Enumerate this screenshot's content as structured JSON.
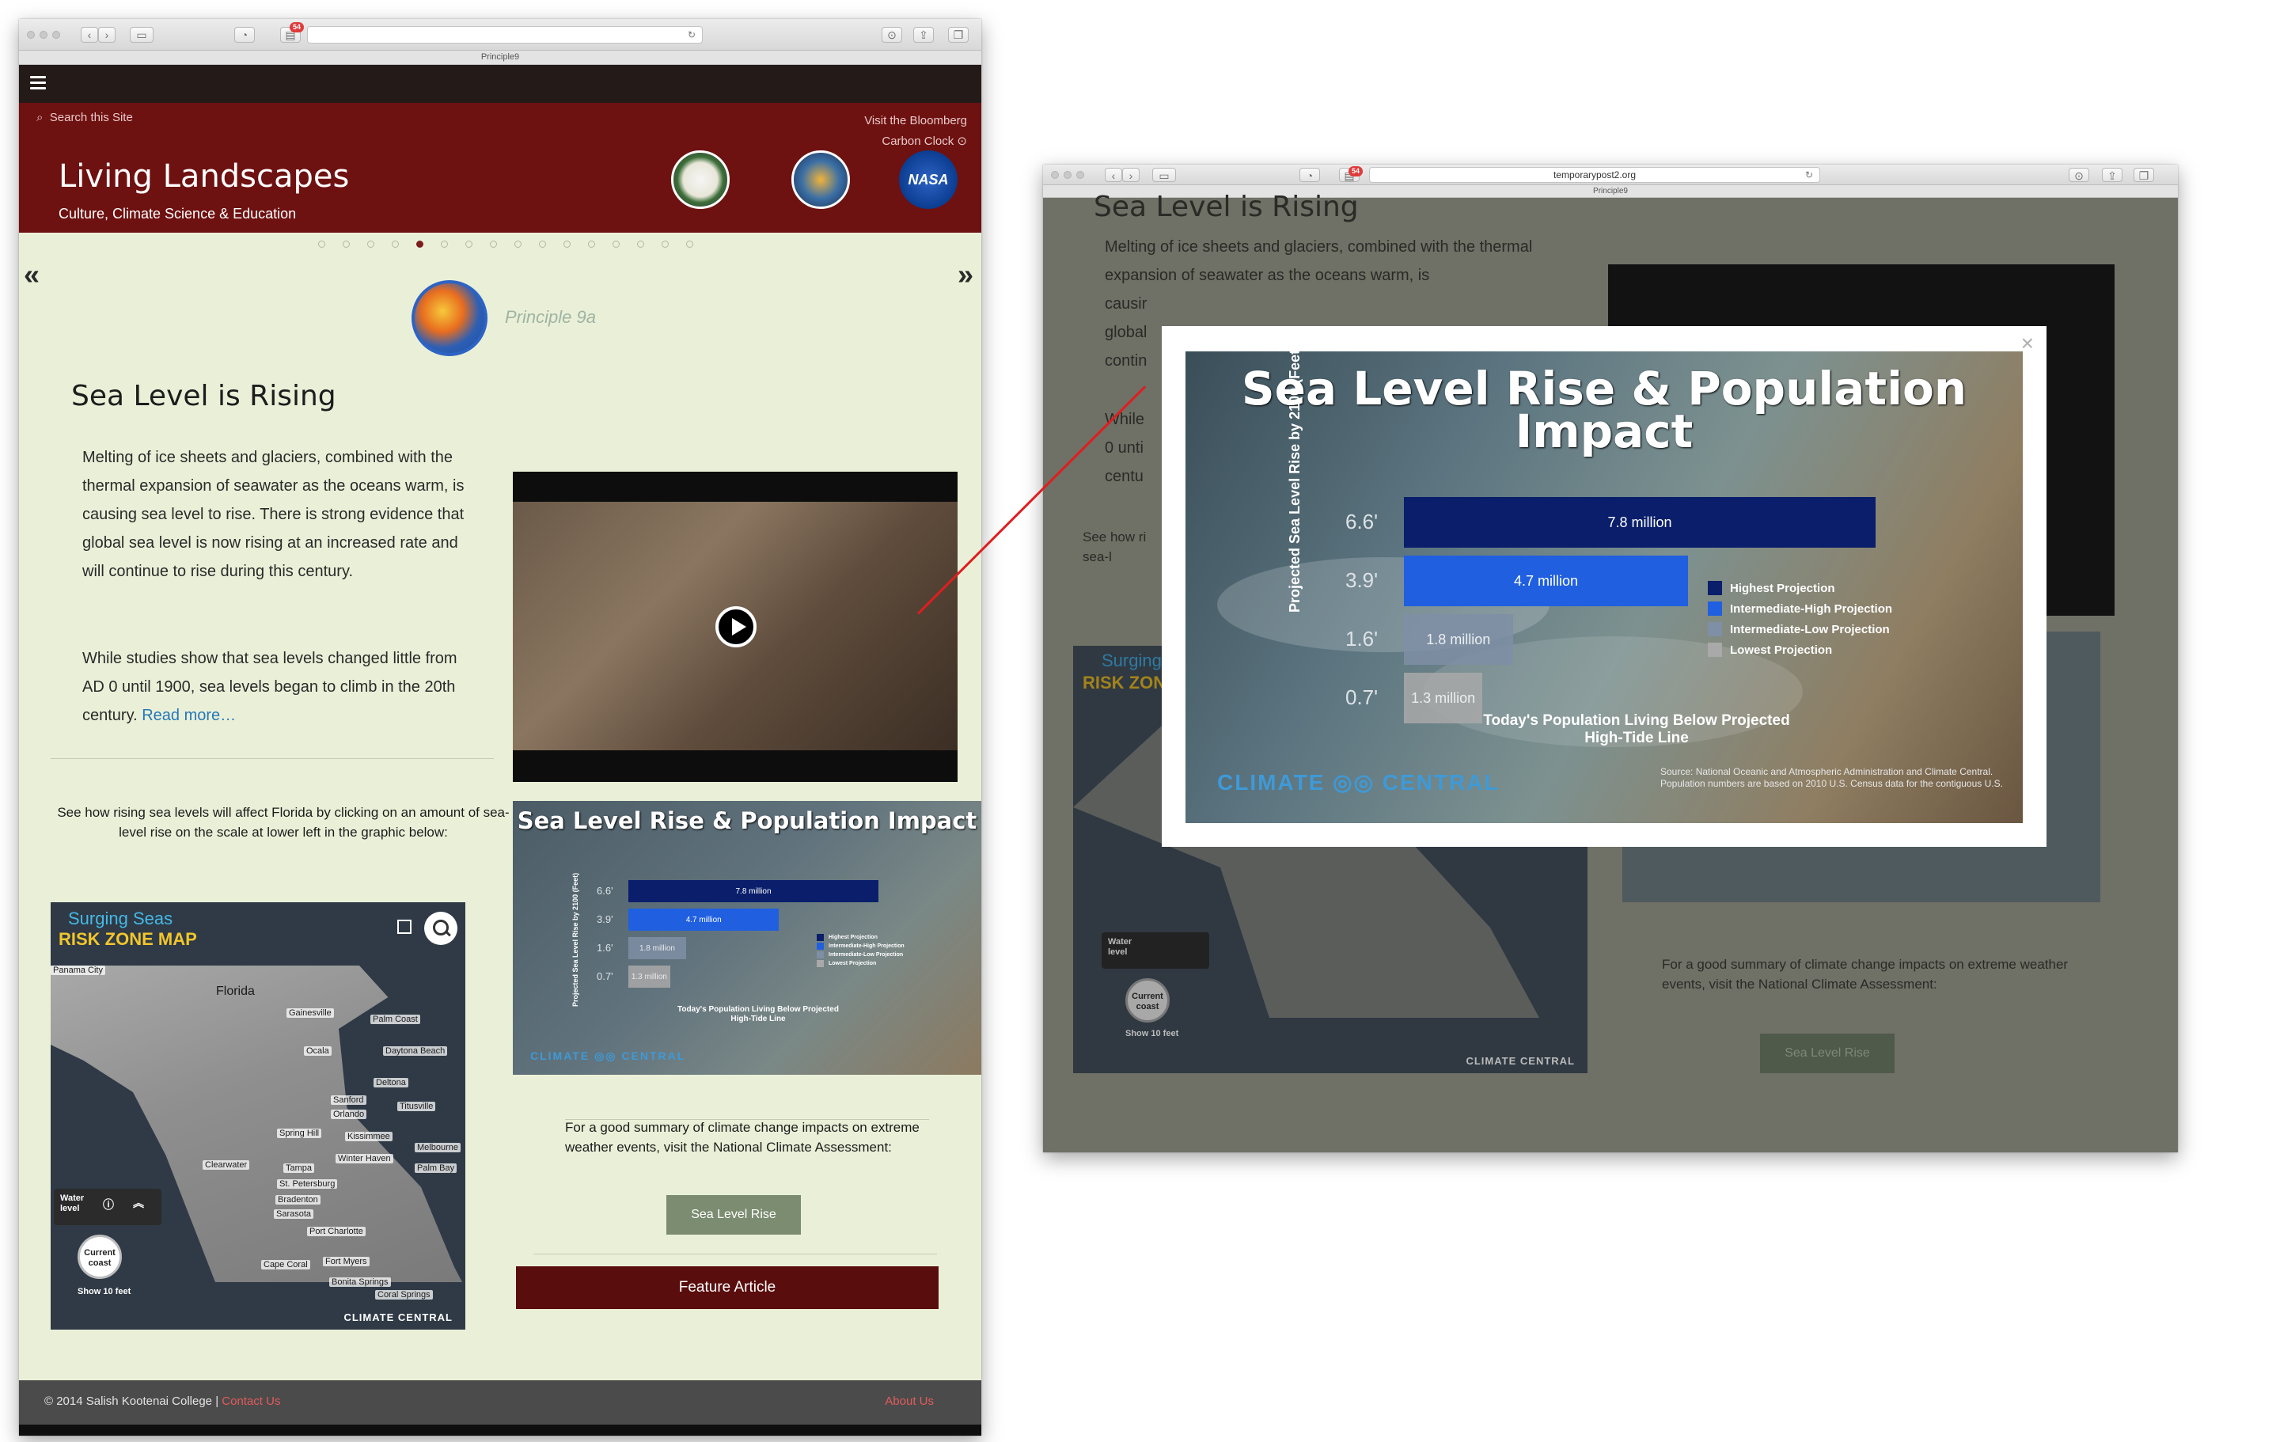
{
  "left_window": {
    "tab_title": "Principle9",
    "badge": "54",
    "site": {
      "search": "Search this Site",
      "bloomberg_line1": "Visit the Bloomberg",
      "bloomberg_line2": "Carbon Clock",
      "title": "Living Landscapes",
      "subtitle": "Culture, Climate Science & Education",
      "principle": "Principle 9a",
      "heading": "Sea Level is Rising",
      "para1": "Melting of ice sheets and glaciers, combined with the thermal expansion of seawater as the oceans warm, is causing sea level to rise. There is strong evidence that global sea level is now rising at an increased rate and will continue to rise during this century.",
      "para2": "While studies show that sea levels changed little from AD 0 until 1900, sea levels began to climb in the 20th century.",
      "read_more": "Read more…",
      "florida_note": "See how rising sea levels will affect Florida by clicking on an amount of sea-level rise on the scale at lower left in the graphic below:",
      "summary_note": "For a good summary of climate change impacts on extreme weather events, visit the National Climate Assessment:",
      "sea_level_button": "Sea Level Rise",
      "feature_button": "Feature Article",
      "footer_copy": "© 2014 Salish Kootenai College | ",
      "footer_contact": "Contact Us",
      "footer_about": "About Us"
    },
    "map": {
      "title1": "Surging Seas",
      "title2": "RISK ZONE MAP",
      "labels": [
        "Panama City",
        "Florida",
        "Gainesville",
        "Palm Coast",
        "Ocala",
        "Daytona Beach",
        "Deltona",
        "Sanford",
        "Orlando",
        "Titusville",
        "Spring Hill",
        "Kissimmee",
        "Melbourne",
        "Clearwater",
        "Tampa",
        "Winter Haven",
        "Palm Bay",
        "St. Petersburg",
        "Bradenton",
        "Sarasota",
        "Port Charlotte",
        "Cape Coral",
        "Fort Myers",
        "Bonita Springs",
        "Coral Springs"
      ],
      "water_level": "Water level",
      "current_coast": "Current coast",
      "show": "Show 10 feet",
      "logo": "CLIMATE CENTRAL"
    }
  },
  "right_window": {
    "url": "temporarypost2.org",
    "tab_title": "Principle9",
    "badge": "54",
    "bg_heading": "Sea Level is Rising",
    "bg_para1": "Melting of ice sheets and glaciers, combined with the thermal expansion of seawater as the oceans warm, is",
    "bg_para_fragments": [
      "causir",
      "global",
      "contin",
      "While",
      "0 unti",
      "centu"
    ],
    "bg_see": "See how ri",
    "bg_see2": "sea-l",
    "bg_summary": "For a good summary of climate change impacts on extreme weather events, visit the National Climate Assessment:",
    "bg_button": "Sea Level Rise",
    "bg_map_title1": "Surging",
    "bg_map_title2": "RISK ZON",
    "bg_water": "Water level",
    "bg_current": "Current coast",
    "bg_show": "Show 10 feet",
    "bg_logo": "CLIMATE CENTRAL",
    "close": "×"
  },
  "chart_data": {
    "type": "bar",
    "title": "Sea Level Rise & Population Impact",
    "ylabel": "Projected Sea Level Rise by 2100 (Feet)",
    "categories": [
      "6.6'",
      "3.9'",
      "1.6'",
      "0.7'"
    ],
    "values": [
      7.8,
      4.7,
      1.8,
      1.3
    ],
    "value_labels": [
      "7.8 million",
      "4.7 million",
      "1.8 million",
      "1.3 million"
    ],
    "colors": [
      "#0a1e6b",
      "#1f5fe0",
      "#7f8fa6",
      "#a9a9a9"
    ],
    "legend": [
      "Highest Projection",
      "Intermediate-High Projection",
      "Intermediate-Low Projection",
      "Lowest Projection"
    ],
    "note": "Today's Population Living Below Projected High-Tide Line",
    "source": "Source: National Oceanic and Atmospheric Administration and Climate Central. Population numbers are based on 2010 U.S. Census data for the contiguous U.S.",
    "logo_left": "CLIMATE",
    "logo_right": "CENTRAL"
  }
}
